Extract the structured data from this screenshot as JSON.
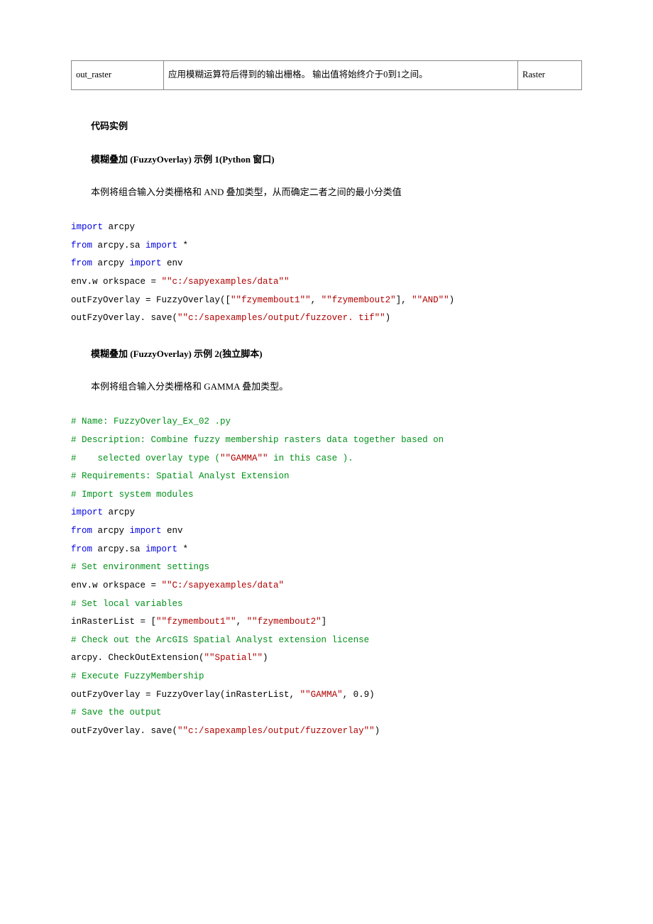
{
  "table": {
    "row": {
      "name": "out_raster",
      "desc": "应用模糊运算符后得到的输出栅格。 输出值将始终介于0到1之间。",
      "type": "Raster"
    }
  },
  "h1": "代码实例",
  "ex1": {
    "heading": "模糊叠加 (FuzzyOverlay) 示例 1(Python 窗口)",
    "para": "本例将组合输入分类栅格和 AND 叠加类型，从而确定二者之间的最小分类值",
    "code": {
      "l1a": "import",
      "l1b": " arcpy",
      "l2a": "from",
      "l2b": " arcpy.sa ",
      "l2c": "import",
      "l2d": " *",
      "l3a": "from",
      "l3b": " arcpy ",
      "l3c": "import",
      "l3d": " env",
      "l4a": "env.w orkspace = ",
      "l4b": "\"\"c:/sapyexamples/data\"\"",
      "l5a": "outFzyOverlay = FuzzyOverlay([",
      "l5b": "\"\"fzymembout1\"\"",
      "l5c": ", ",
      "l5d": "\"\"fzymembout2\"",
      "l5e": "], ",
      "l5f": "\"\"AND\"\"",
      "l5g": ")",
      "l6a": "outFzyOverlay. save(",
      "l6b": "\"\"c:/sapexamples/output/fuzzover. tif\"\"",
      "l6c": ")"
    }
  },
  "ex2": {
    "heading": "模糊叠加 (FuzzyOverlay) 示例 2(独立脚本)",
    "para": "本例将组合输入分类栅格和 GAMMA 叠加类型。",
    "code": {
      "c1": "# Name: FuzzyOverlay_Ex_02 .py",
      "c2": "# Description: Combine fuzzy membership rasters data together based on",
      "c3a": "#    selected overlay type (",
      "c3b": "\"\"GAMMA\"\"",
      "c3c": " in this case ).",
      "c4": "# Requirements: Spatial Analyst Extension",
      "c5": "# Import system modules",
      "l6a": "import",
      "l6b": " arcpy",
      "l7a": "from",
      "l7b": " arcpy ",
      "l7c": "import",
      "l7d": " env",
      "l8a": "from",
      "l8b": " arcpy.sa ",
      "l8c": "import",
      "l8d": " *",
      "c9": "# Set environment settings",
      "l10a": "env.w orkspace = ",
      "l10b": "\"\"C:/sapyexamples/data\"",
      "c11": "# Set local variables",
      "l12a": "inRasterList = [",
      "l12b": "\"\"fzymembout1\"\"",
      "l12c": ", ",
      "l12d": "\"\"fzymembout2\"",
      "l12e": "]",
      "c13": "# Check out the ArcGIS Spatial Analyst extension license",
      "l14a": "arcpy. CheckOutExtension(",
      "l14b": "\"\"Spatial\"\"",
      "l14c": ")",
      "c15": "# Execute FuzzyMembership",
      "l16a": "outFzyOverlay = FuzzyOverlay(inRasterList, ",
      "l16b": "\"\"GAMMA\"",
      "l16c": ", 0.9)",
      "c17": "# Save the output",
      "l18a": "outFzyOverlay. save(",
      "l18b": "\"\"c:/sapexamples/output/fuzzoverlay\"\"",
      "l18c": ")"
    }
  }
}
